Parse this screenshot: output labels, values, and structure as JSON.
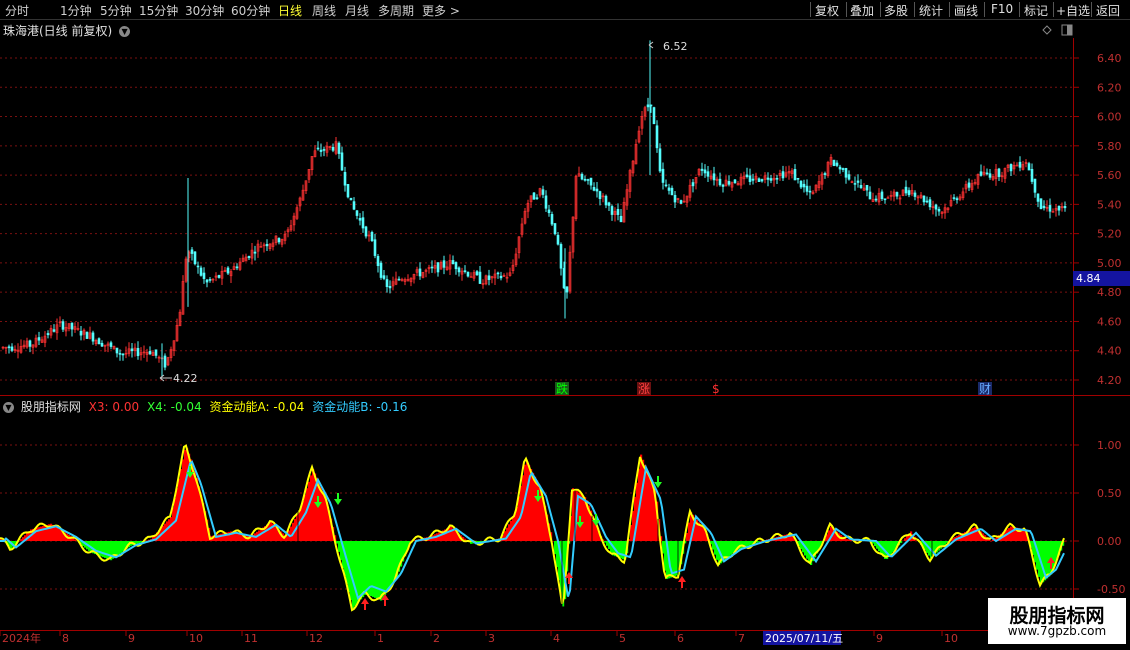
{
  "toolbar": {
    "periods": [
      "分时",
      "1分钟",
      "5分钟",
      "15分钟",
      "30分钟",
      "60分钟",
      "日线",
      "周线",
      "月线",
      "多周期",
      "更多 >"
    ],
    "active_period": "日线",
    "tools": [
      "复权",
      "叠加",
      "多股",
      "统计",
      "画线",
      "F10",
      "标记",
      "+自选",
      "返回"
    ]
  },
  "main_chart": {
    "stock_title": "珠海港(日线 前复权)",
    "price_axis": [
      "6.40",
      "6.20",
      "6.00",
      "5.80",
      "5.60",
      "5.40",
      "5.20",
      "5.00",
      "4.80",
      "4.60",
      "4.40",
      "4.20"
    ],
    "current_price": "4.84",
    "high_label": "6.52",
    "low_label": "4.22",
    "events": [
      "跌",
      "涨",
      "$",
      "财"
    ]
  },
  "indicator": {
    "name": "股朋指标网",
    "x3": "X3: 0.00",
    "x4": "X4: -0.04",
    "fund_a": "资金动能A: -0.04",
    "fund_b": "资金动能B: -0.16",
    "axis": [
      "1.00",
      "0.50",
      "0.00",
      "-0.50"
    ]
  },
  "time_axis": {
    "labels": [
      "2024年",
      "8",
      "9",
      "10",
      "11",
      "12",
      "1",
      "2",
      "3",
      "4",
      "5",
      "6",
      "7",
      "2025/07/11/五",
      "9",
      "10"
    ]
  },
  "watermark": {
    "title": "股朋指标网",
    "url": "www.7gpzb.com"
  },
  "colors": {
    "up": "#ff3232",
    "down": "#54fcfc",
    "grid": "#7a1010",
    "axis": "#a00000",
    "fund_a": "#ffff00",
    "fund_b": "#33ccff",
    "fill_pos": "#ff0000",
    "fill_neg": "#00ff00"
  }
}
